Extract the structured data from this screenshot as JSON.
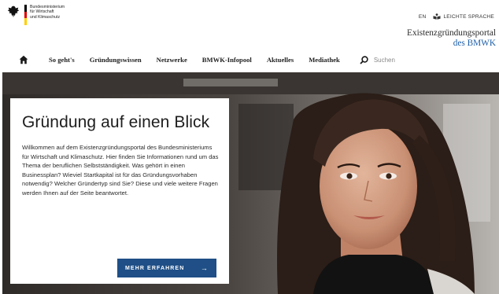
{
  "branding": {
    "ministry_lines": [
      "Bundesministerium",
      "für Wirtschaft",
      "und Klimaschutz"
    ],
    "portal_title": "Existenzgründungsportal",
    "portal_subtitle": "des BMWK"
  },
  "meta": {
    "lang_link": "EN",
    "easy_language": "LEICHTE SPRACHE"
  },
  "nav": {
    "items": [
      "So geht's",
      "Gründungswissen",
      "Netzwerke",
      "BMWK-Infopool",
      "Aktuelles",
      "Mediathek"
    ],
    "search_placeholder": "Suchen"
  },
  "hero": {
    "title": "Gründung auf einen Blick",
    "text": "Willkommen auf dem Existenzgründungsportal des Bundesministeriums für Wirtschaft und Klimaschutz. Hier finden Sie Informationen rund um das Thema der beruflichen Selbstständigkeit. Was gehört in einen Businessplan? Wieviel Startkapital ist für das Gründungsvorhaben notwendig? Welcher Gründertyp sind Sie? Diese und viele weitere Fragen werden Ihnen auf der Seite beantwortet.",
    "cta_label": "MEHR ERFAHREN",
    "cta_arrow": "→"
  },
  "colors": {
    "brand_blue": "#1f4f86",
    "flag_black": "#000000",
    "flag_red": "#dd0000",
    "flag_gold": "#ffce00"
  },
  "icons": {
    "logo": "federal-eagle-icon",
    "home": "home-icon",
    "search": "search-icon",
    "easy_language": "easy-language-icon",
    "cta": "arrow-right-icon"
  }
}
